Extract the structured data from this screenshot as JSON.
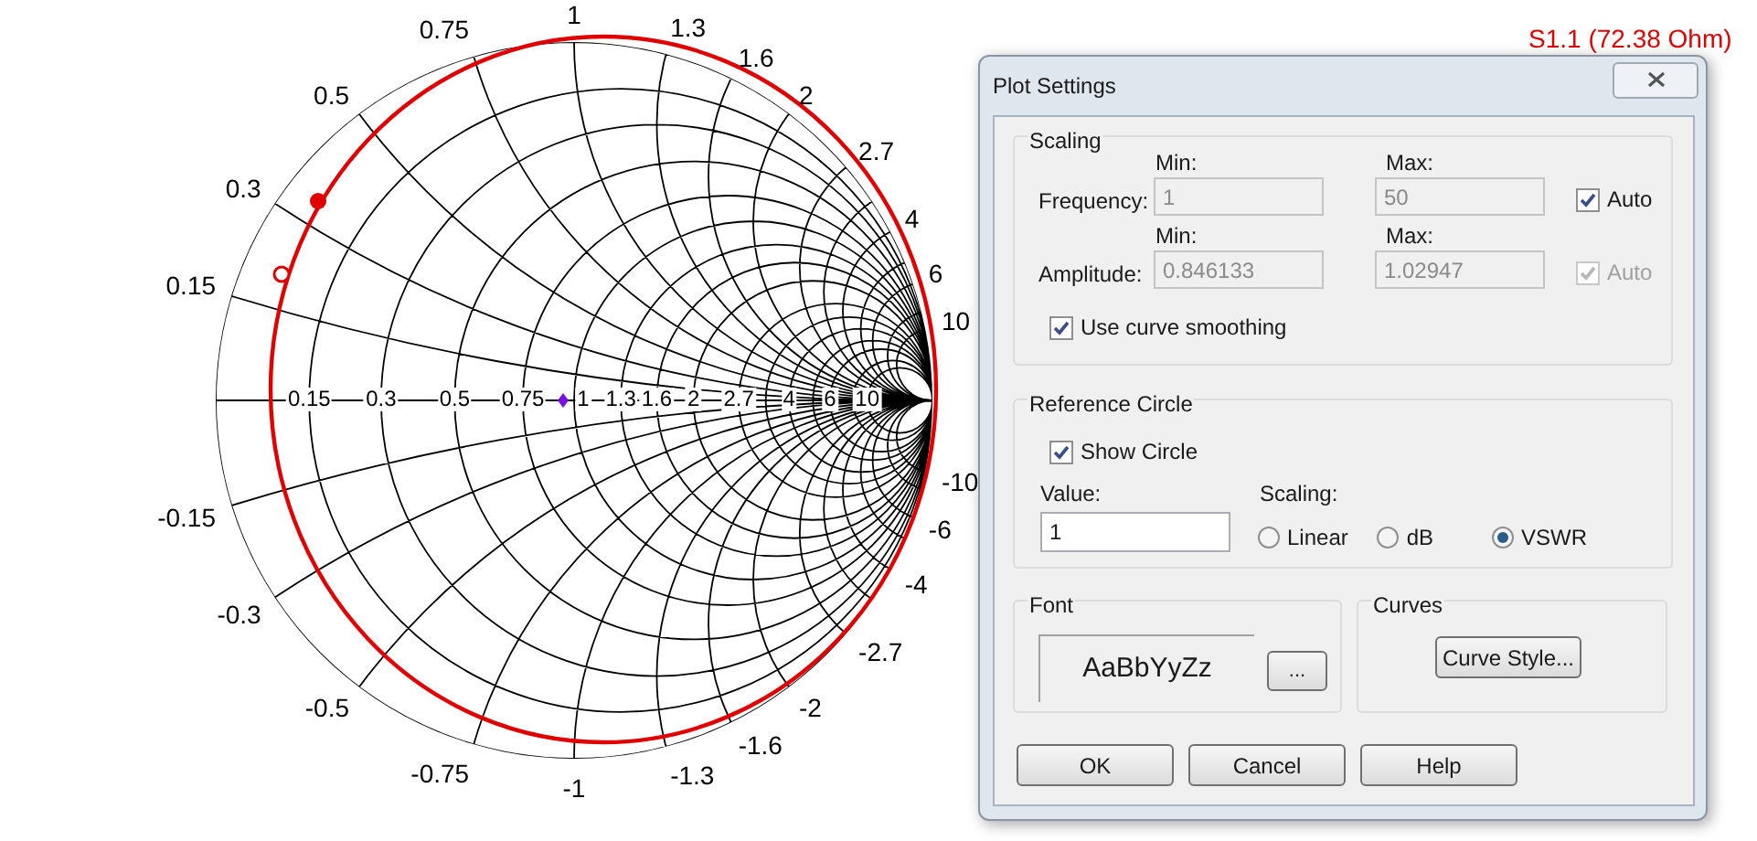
{
  "chart_title": "S1.1 (72.38 Ohm)",
  "smith_chart": {
    "axis_labels": [
      "0.15",
      "0.3",
      "0.5",
      "0.75",
      "1",
      "1.3",
      "1.6",
      "2",
      "2.7",
      "4",
      "6",
      "10"
    ],
    "upper_labels": [
      "0.15",
      "0.3",
      "0.5",
      "0.75",
      "1",
      "1.3",
      "1.6",
      "2",
      "2.7",
      "4",
      "6",
      "10"
    ],
    "lower_labels": [
      "-0.15",
      "-0.3",
      "-0.5",
      "-0.75",
      "-1",
      "-1.3",
      "-1.6",
      "-2",
      "-2.7",
      "-4",
      "-6",
      "-10"
    ]
  },
  "dialog": {
    "title": "Plot Settings",
    "scaling": {
      "title": "Scaling",
      "rows": [
        {
          "label": "Frequency:",
          "min_label": "Min:",
          "min": "1",
          "max_label": "Max:",
          "max": "50",
          "disabled": true,
          "auto": {
            "label": "Auto",
            "checked": true,
            "disabled": false
          }
        },
        {
          "label": "Amplitude:",
          "min_label": "Min:",
          "min": "0.846133",
          "max_label": "Max:",
          "max": "1.02947",
          "disabled": true,
          "auto": {
            "label": "Auto",
            "checked": true,
            "disabled": true
          }
        }
      ],
      "smoothing": {
        "label": "Use curve smoothing",
        "checked": true
      }
    },
    "reference_circle": {
      "title": "Reference Circle",
      "show": {
        "label": "Show Circle",
        "checked": true
      },
      "value_label": "Value:",
      "value": "1",
      "scaling_label": "Scaling:",
      "options": [
        {
          "label": "Linear",
          "selected": false
        },
        {
          "label": "dB",
          "selected": false
        },
        {
          "label": "VSWR",
          "selected": true
        }
      ]
    },
    "font": {
      "title": "Font",
      "sample": "AaBbYyZz",
      "button": "..."
    },
    "curves": {
      "title": "Curves",
      "button": "Curve Style..."
    },
    "buttons": [
      "OK",
      "Cancel",
      "Help"
    ]
  }
}
